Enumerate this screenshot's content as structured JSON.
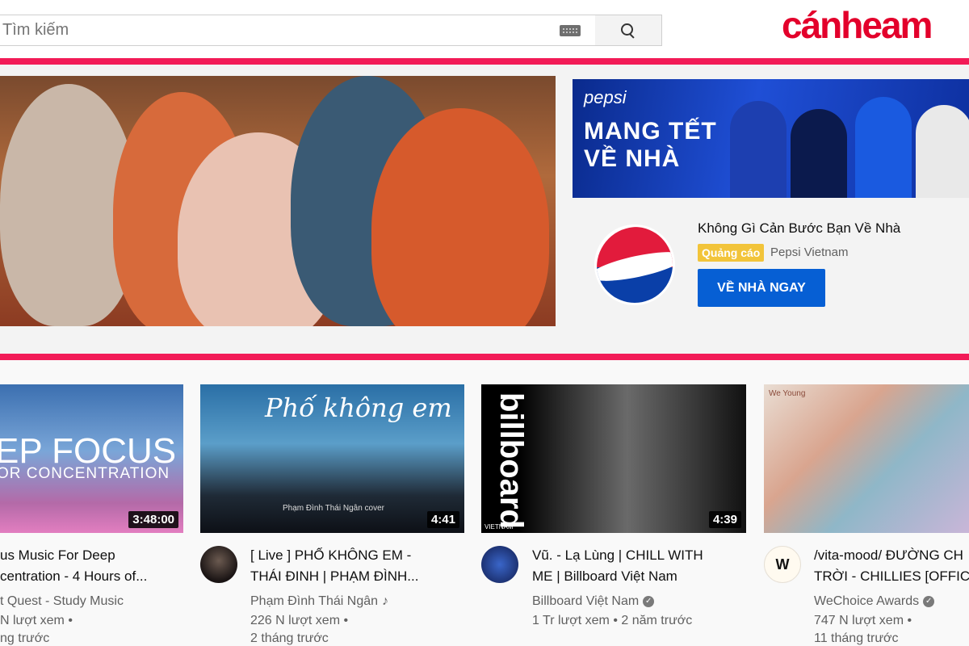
{
  "search": {
    "placeholder": "Tìm kiếm"
  },
  "brand": {
    "name": "cánheam"
  },
  "ad": {
    "banner_brand": "pepsi",
    "banner_line1": "MANG TẾT",
    "banner_line2": "VỀ NHÀ",
    "title": "Không Gì Cản Bước Bạn Về Nhà",
    "badge": "Quảng cáo",
    "channel": "Pepsi Vietnam",
    "cta": "VỀ NHÀ NGAY"
  },
  "videos": [
    {
      "duration": "3:48:00",
      "thumb_line1": "EP FOCUS",
      "thumb_line2": "OR CONCENTRATION",
      "title_line1": "us Music For Deep",
      "title_line2": "centration - 4 Hours of...",
      "channel": "t Quest - Study Music",
      "views": "N lượt xem •",
      "age": "ng trước"
    },
    {
      "duration": "4:41",
      "thumb_line1": "Phố không em",
      "thumb_line2": "Phạm Đình Thái Ngân cover",
      "title_line1": "[ Live ] PHỐ KHÔNG EM -",
      "title_line2": "THÁI ĐINH | PHẠM ĐÌNH...",
      "channel": "Phạm Đình Thái Ngân",
      "views": "226 N lượt xem •",
      "age": "2 tháng trước"
    },
    {
      "duration": "4:39",
      "thumb_line1": "billboard",
      "thumb_line2": "VIETNAM",
      "title_line1": "Vũ. - Lạ Lùng | CHILL WITH",
      "title_line2": "ME | Billboard Việt Nam",
      "channel": "Billboard Việt Nam",
      "views": "1 Tr lượt xem • 2 năm trước",
      "age": ""
    },
    {
      "duration": "",
      "thumb_line1": "We Young",
      "thumb_line2": "",
      "title_line1": "/vita-mood/ ĐƯỜNG CH",
      "title_line2": "TRỜI - CHILLIES [OFFICI",
      "channel": "WeChoice Awards",
      "views": "747 N lượt xem •",
      "age": "11 tháng trước"
    }
  ],
  "colors": {
    "accent": "#f21b57",
    "brand": "#e3002b",
    "cta": "#065fd4",
    "badge": "#f2c43a"
  },
  "icons": {
    "keyboard": "keyboard-icon",
    "search": "search-icon",
    "verified": "verified-check-icon",
    "music": "music-note-icon"
  }
}
